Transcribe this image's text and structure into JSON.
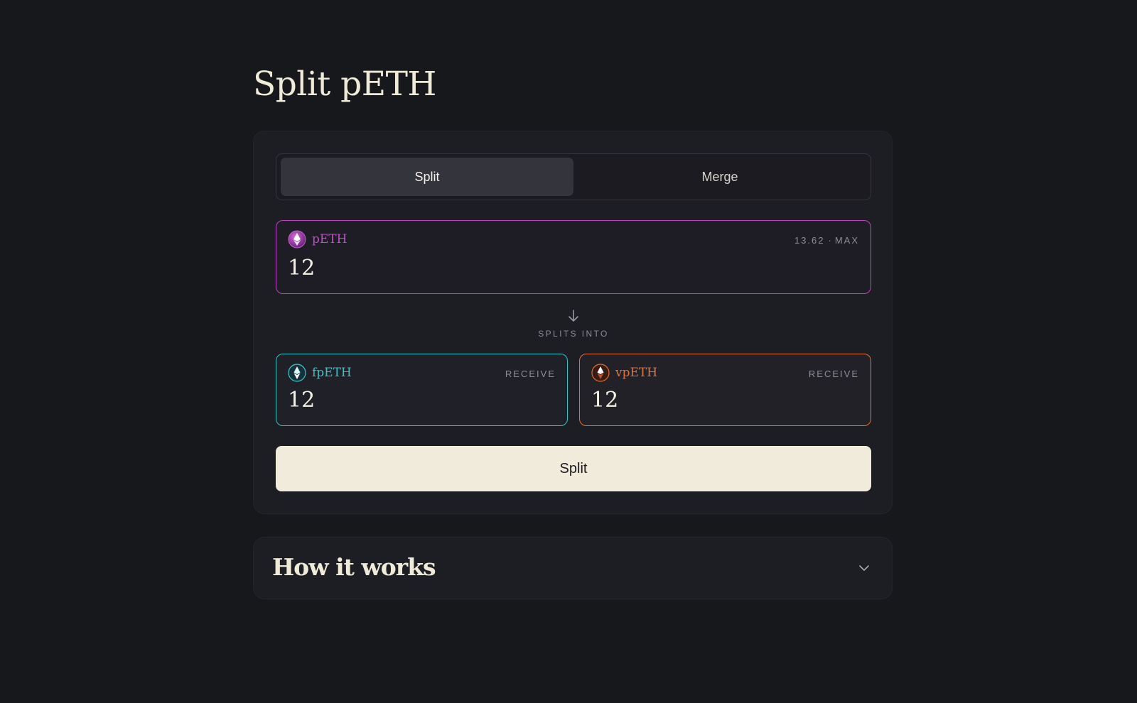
{
  "page": {
    "title": "Split pETH"
  },
  "tabs": {
    "split_label": "Split",
    "merge_label": "Merge",
    "active": "Split"
  },
  "input_token": {
    "name": "pETH",
    "icon": "peth-icon",
    "balance": "13.62",
    "separator": "·",
    "max_label": "MAX",
    "amount": "12",
    "color": "#c043c4"
  },
  "divider": {
    "icon": "arrow-down-icon",
    "label": "SPLITS INTO"
  },
  "outputs": [
    {
      "name": "fpETH",
      "icon": "fpeth-icon",
      "meta": "RECEIVE",
      "amount": "12",
      "color": "#2fc6c6"
    },
    {
      "name": "vpETH",
      "icon": "vpeth-icon",
      "meta": "RECEIVE",
      "amount": "12",
      "color": "#e56f2c"
    }
  ],
  "action": {
    "label": "Split"
  },
  "how_it_works": {
    "title": "How it works",
    "icon": "chevron-down-icon"
  }
}
